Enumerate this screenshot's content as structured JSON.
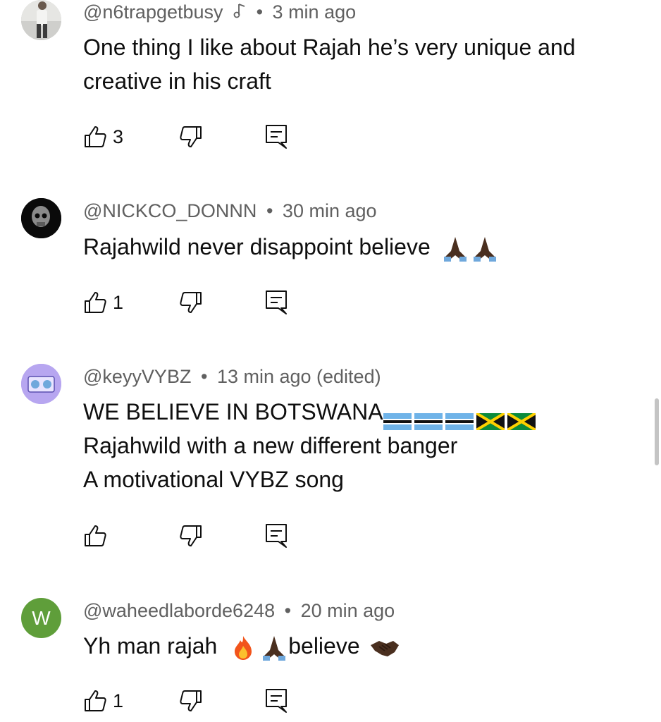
{
  "comments": [
    {
      "handle": "@n6trapgetbusy",
      "time": "3 min ago",
      "lines": [
        "One thing I like about Rajah he’s very unique and",
        "creative in his craft"
      ],
      "likes": "3",
      "has_music_badge": true
    },
    {
      "handle": "@NICKCO_DONNN",
      "time": "30 min ago",
      "lines": [
        "Rajahwild never disappoint believe"
      ],
      "likes": "1",
      "emojis": [
        "folded-hands",
        "folded-hands"
      ]
    },
    {
      "handle": "@keyyVYBZ",
      "time": "13 min ago (edited)",
      "lines": [
        "WE BELIEVE IN BOTSWANA",
        "Rajahwild with a new different banger",
        "A motivational VYBZ song"
      ],
      "likes": "",
      "emojis": [
        "flag-botswana",
        "flag-botswana",
        "flag-botswana",
        "flag-jamaica",
        "flag-jamaica"
      ]
    },
    {
      "handle": "@waheedlaborde6248",
      "time": "20 min ago",
      "line_parts": [
        "Yh man rajah",
        "believe"
      ],
      "likes": "1",
      "avatar_letter": "W",
      "emojis": [
        "fire",
        "folded-hands",
        "handshake"
      ]
    }
  ],
  "separator": "•",
  "icons": {
    "like": "thumbs-up-icon",
    "dislike": "thumbs-down-icon",
    "reply": "reply-comment-icon",
    "music": "music-note-icon"
  },
  "colors": {
    "avatar_w": "#5f9e3a",
    "avatar_keyy": "#b7a6f0",
    "meta_text": "#606060"
  }
}
